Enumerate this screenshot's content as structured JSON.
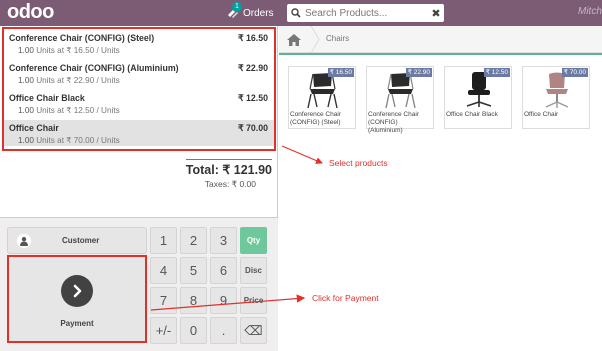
{
  "header": {
    "logo": "odoo",
    "orders_badge": "1",
    "orders_label": "Orders",
    "search_placeholder": "Search Products...",
    "user_name": "Mitch"
  },
  "order": {
    "lines": [
      {
        "name": "Conference Chair (CONFIG) (Steel)",
        "price": "₹ 16.50",
        "qty": "1.00",
        "detail": "Units at ₹ 16.50 / Units",
        "selected": false
      },
      {
        "name": "Conference Chair (CONFIG) (Aluminium)",
        "price": "₹ 22.90",
        "qty": "1.00",
        "detail": "Units at ₹ 22.90 / Units",
        "selected": false
      },
      {
        "name": "Office Chair Black",
        "price": "₹ 12.50",
        "qty": "1.00",
        "detail": "Units at ₹ 12.50 / Units",
        "selected": false
      },
      {
        "name": "Office Chair",
        "price": "₹ 70.00",
        "qty": "1.00",
        "detail": "Units at ₹ 70.00 / Units",
        "selected": true
      }
    ],
    "total": "Total: ₹ 121.90",
    "taxes": "Taxes: ₹ 0.00"
  },
  "controls": {
    "customer_label": "Customer",
    "payment_label": "Payment",
    "numpad": [
      {
        "label": "1",
        "mode": false,
        "active": false
      },
      {
        "label": "2",
        "mode": false,
        "active": false
      },
      {
        "label": "3",
        "mode": false,
        "active": false
      },
      {
        "label": "Qty",
        "mode": true,
        "active": true
      },
      {
        "label": "4",
        "mode": false,
        "active": false
      },
      {
        "label": "5",
        "mode": false,
        "active": false
      },
      {
        "label": "6",
        "mode": false,
        "active": false
      },
      {
        "label": "Disc",
        "mode": true,
        "active": false
      },
      {
        "label": "7",
        "mode": false,
        "active": false
      },
      {
        "label": "8",
        "mode": false,
        "active": false
      },
      {
        "label": "9",
        "mode": false,
        "active": false
      },
      {
        "label": "Price",
        "mode": true,
        "active": false
      },
      {
        "label": "+/-",
        "mode": false,
        "active": false
      },
      {
        "label": "0",
        "mode": false,
        "active": false
      },
      {
        "label": ".",
        "mode": false,
        "active": false
      },
      {
        "label": "⌫",
        "mode": false,
        "active": false
      }
    ]
  },
  "catalog": {
    "breadcrumb": "Chairs",
    "products": [
      {
        "name": "Conference Chair (CONFIG) (Steel)",
        "price": "₹ 16.50",
        "image": "conference-chair-icon"
      },
      {
        "name": "Conference Chair (CONFIG) (Aluminium)",
        "price": "₹ 22.90",
        "image": "conference-chair-icon"
      },
      {
        "name": "Office Chair Black",
        "price": "₹ 12.50",
        "image": "office-chair-black-icon"
      },
      {
        "name": "Office Chair",
        "price": "₹ 70.00",
        "image": "office-chair-pink-icon"
      }
    ]
  },
  "annotations": {
    "select_products": "Select products",
    "click_payment": "Click for Payment"
  },
  "colors": {
    "topbar": "#7c5c74",
    "accent": "#6ec89b",
    "annotation": "#e0302a",
    "price_tag": "#6c7ba3"
  }
}
